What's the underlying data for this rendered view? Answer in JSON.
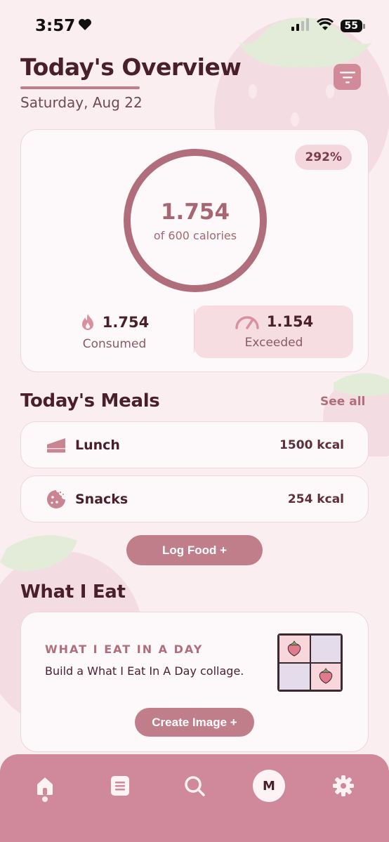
{
  "status_bar": {
    "time": "3:57",
    "battery": "55"
  },
  "header": {
    "title": "Today's Overview",
    "date": "Saturday, Aug 22"
  },
  "overview": {
    "percent_badge": "292%",
    "ring_value": "1.754",
    "ring_sub": "of 600 calories",
    "consumed": {
      "value": "1.754",
      "label": "Consumed"
    },
    "exceeded": {
      "value": "1.154",
      "label": "Exceeded"
    }
  },
  "meals": {
    "title": "Today's Meals",
    "see_all": "See all",
    "items": [
      {
        "name": "Lunch",
        "kcal": "1500 kcal",
        "icon": "cake-slice-icon"
      },
      {
        "name": "Snacks",
        "kcal": "254 kcal",
        "icon": "cookie-icon"
      }
    ],
    "log_button": "Log Food +"
  },
  "what_i_eat": {
    "title": "What I Eat",
    "card_heading": "WHAT I EAT IN A DAY",
    "card_desc": "Build a What I Eat In A Day collage.",
    "create_button": "Create Image +"
  },
  "tabbar": {
    "items": [
      "home-icon",
      "list-icon",
      "search-icon",
      "profile-avatar",
      "settings-icon"
    ],
    "avatar_letter": "M",
    "active": "home"
  },
  "colors": {
    "background": "#fbeef0",
    "accent": "#c07e8b",
    "ring": "#b06e7c",
    "tabbar": "#d0899a",
    "text_dark": "#4a1f2c"
  }
}
